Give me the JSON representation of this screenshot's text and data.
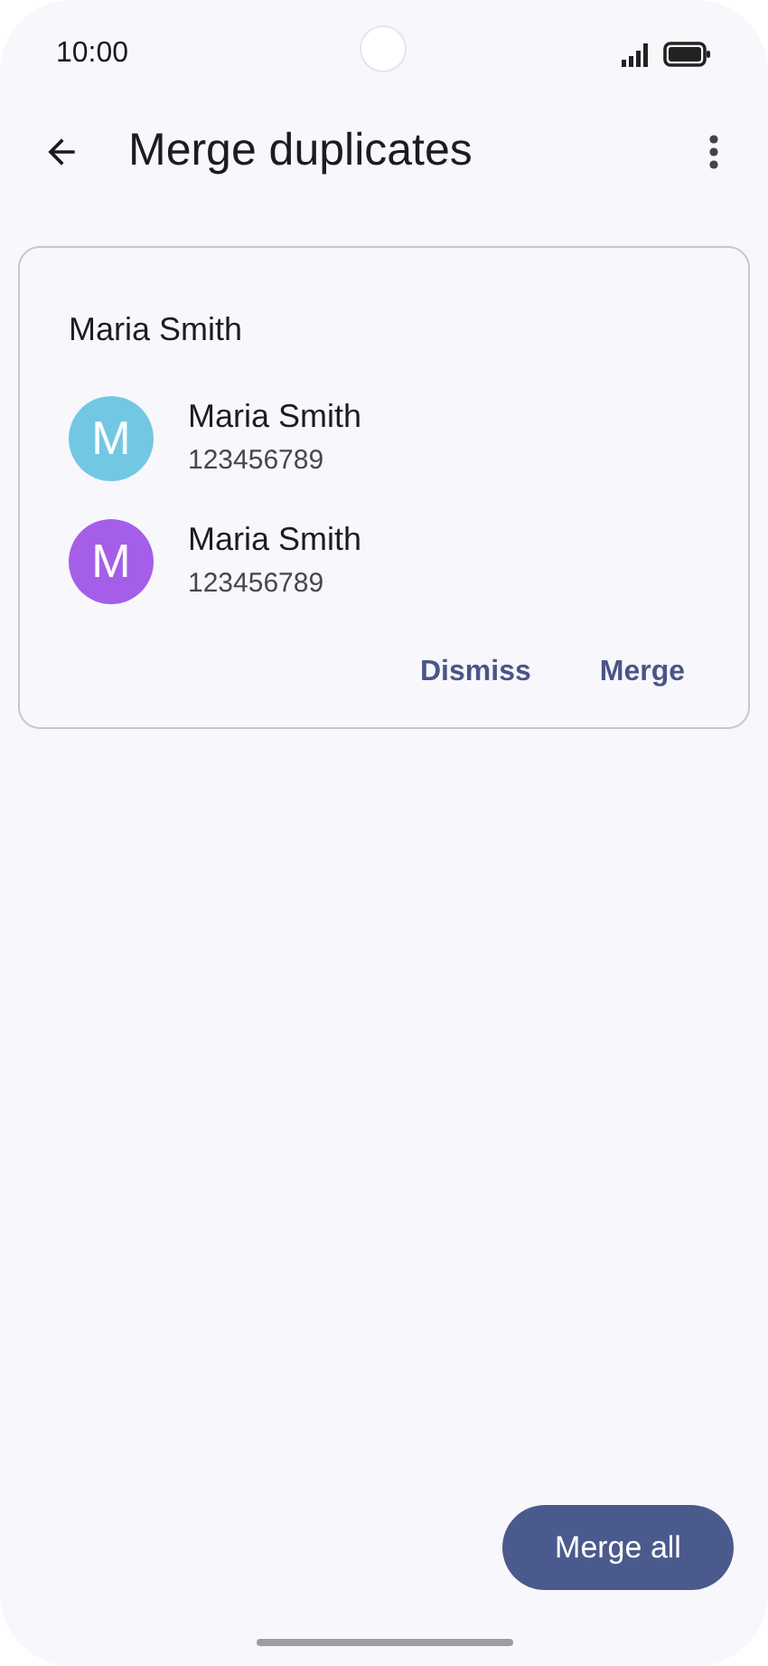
{
  "status_bar": {
    "time": "10:00"
  },
  "app_bar": {
    "title": "Merge duplicates"
  },
  "card": {
    "title": "Maria Smith",
    "contacts": [
      {
        "initial": "M",
        "name": "Maria Smith",
        "number": "123456789",
        "color": "#72c8e2"
      },
      {
        "initial": "M",
        "name": "Maria Smith",
        "number": "123456789",
        "color": "#a55ee8"
      }
    ],
    "actions": [
      "Dismiss",
      "Merge"
    ]
  },
  "fab": {
    "label": "Merge all"
  }
}
